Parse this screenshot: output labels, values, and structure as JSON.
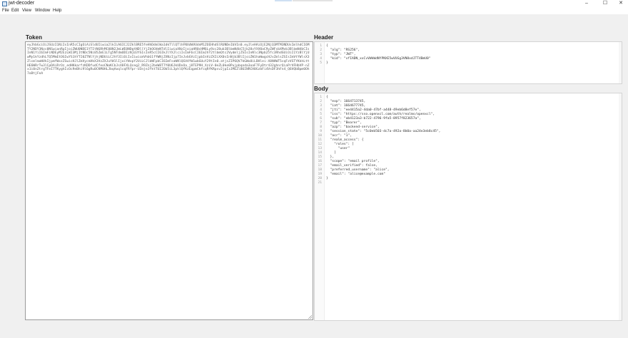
{
  "window": {
    "title": "jwt-decoder",
    "controls": {
      "minimize": "–",
      "maximize": "☐",
      "close": "✕"
    }
  },
  "menu": [
    "File",
    "Edit",
    "View",
    "Window",
    "Help"
  ],
  "token": {
    "label": "Token",
    "value": "eyJhbGciOiJSUzI1NiIsInR5cCIgOiAiSldUIiwia2lkIiA6ICJ2ZklBRE5feHhDdmlWa1dkTllQTlhFNXdWVUdnM1ZOEHhdSlRUNDeIbVIn0.eyJleHAiOjE2NjQ3MTM3NDUsImlhdCI6MTY2NDY3Nzc0NSwianRpIjoiZWU0NDE1YTItNGRhMC00N2JmLWE0NDgtNDllYjZkOGVmNTdlIiwiaXNzIjoiaHR0cHM6Ly9zc28ub3BlbmN4bC5jb20vYXV0aC9yZWFsbXMvb3BlbmN4bCIsInN1YiI6ImFiNDEyM2EzLWI3MjItNDc5Ni05ZmE1LTg5NTdmODIzNjU3YSIsInR5cCI6IkJlYXJlciIsImF6cCI6ImJhY2tlbmQtc2VydmljZSIsInNlc3Npb25fc3RhdGUiOiI1YzBlYjUwMy1kYzdhLTQ5MmEtOGIwYS1hYTI0ZTNlYjhjNDUiLCJhY3IiOiIxIiwicmVhbG1fYWNjZXNzIjp7InJvbGVzIjpbInVzZXIiXX0sInNjb3BlIjoiZW1haWwgcHJvZmlsZSIsImVtYWlsX3ZlcmlmaWVkIjpmYWxzZSwicHJlZmVycmVkX3VzZXJuYW1lIjoiYWxpY2UiLCJlbWFpbCI6ImFsaWNlQGV4YW1wbGUuY29tIn0.atjsZIP6QV7kGWo8iLBHlei-X0NHWT5cqFzVSTYKkhLttHE6WRrTw3lCpDAiRrOz_edHKkarfzKDDfudCfeoCNoKCbJsX8FXLQceg2_R9Znj2beW8T7Y0U6JkUDxOa_j8TEP9H_XzLV-0eZL0ke0Pujpbqnda3oaF7FyDtr432ghnrQiaPrVFHbVP-nZx1i0nZtrgTFeI7TKyghIcOc9eBhi9l6gRu0CKM0HLJbqAoqlcqFRfpr-U3njeJfktTUI2Ob5iL3phlQfKzEqpmCkfcqRfKRpsv2jpIzJMEZlB6INRCH0GzbFi4VsDF3hFn4_Q6VQbBpm0Oh7oBtjFeA"
  },
  "header": {
    "label": "Header",
    "lines": [
      "{",
      "  \"alg\": \"RS256\",",
      "  \"typ\": \"JWT\",",
      "  \"kid\": \"vfIADN_xxCvVWkWdNYPNXE5wVUGg3VN8xdJTT4BmU0\"",
      "}"
    ]
  },
  "body": {
    "label": "Body",
    "lines": [
      "{",
      "  \"exp\": 1664713745,",
      "  \"iat\": 1664677745,",
      "  \"jti\": \"ee4415a2-4da0-47bf-a448-49eb6d8ef57e\",",
      "  \"iss\": \"https://sso.openxcl.com/auth/realms/openxcl\",",
      "  \"sub\": \"ab4123a3-b722-4796-9fa5-8957f823657a\",",
      "  \"typ\": \"Bearer\",",
      "  \"azp\": \"backend-service\",",
      "  \"session_state\": \"5c0eb503-dc7a-492a-8b0a-aa24e3eb8c45\",",
      "  \"acr\": \"1\",",
      "  \"realm_access\": {",
      "    \"roles\": [",
      "      \"user\"",
      "    ]",
      "  },",
      "  \"scope\": \"email profile\",",
      "  \"email_verified\": false,",
      "  \"preferred_username\": \"alice\",",
      "  \"email\": \"alice@example.com\"",
      "}",
      ""
    ]
  }
}
